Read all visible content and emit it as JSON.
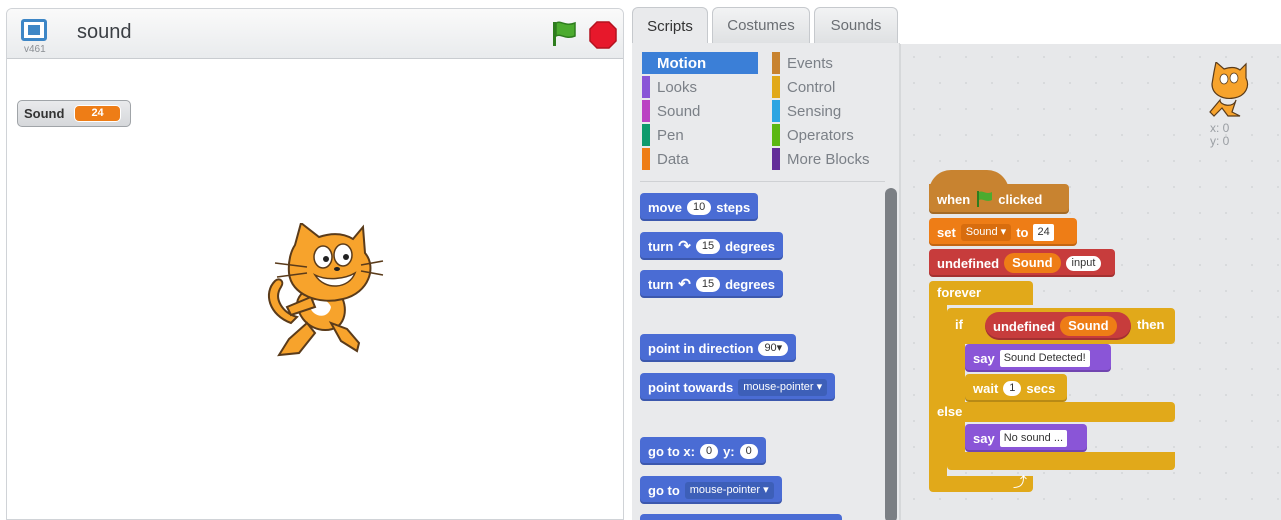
{
  "stage": {
    "title": "sound",
    "version": "v461",
    "monitor": {
      "label": "Sound",
      "value": "24"
    }
  },
  "tabs": [
    {
      "label": "Scripts",
      "active": true
    },
    {
      "label": "Costumes",
      "active": false
    },
    {
      "label": "Sounds",
      "active": false
    }
  ],
  "categories": [
    {
      "label": "Motion",
      "color": "#4a6cd4",
      "active": true
    },
    {
      "label": "Looks",
      "color": "#8a55d7"
    },
    {
      "label": "Sound",
      "color": "#bb42c3"
    },
    {
      "label": "Pen",
      "color": "#0e9a6c"
    },
    {
      "label": "Data",
      "color": "#ee7d16"
    },
    {
      "label": "Events",
      "color": "#c88330"
    },
    {
      "label": "Control",
      "color": "#e1a91a"
    },
    {
      "label": "Sensing",
      "color": "#2ca5e2"
    },
    {
      "label": "Operators",
      "color": "#5cb712"
    },
    {
      "label": "More Blocks",
      "color": "#632d99"
    }
  ],
  "palette": {
    "move": {
      "pre": "move",
      "num": "10",
      "post": "steps"
    },
    "turn_right": {
      "pre": "turn",
      "icon": "rotate-right-icon",
      "num": "15",
      "post": "degrees"
    },
    "turn_left": {
      "pre": "turn",
      "icon": "rotate-left-icon",
      "num": "15",
      "post": "degrees"
    },
    "point_direction": {
      "pre": "point in direction",
      "value": "90▾"
    },
    "point_towards": {
      "pre": "point towards",
      "value": "mouse-pointer ▾"
    },
    "goto_xy": {
      "pre": "go to x:",
      "x": "0",
      "mid": "y:",
      "y": "0"
    },
    "goto": {
      "pre": "go to",
      "value": "mouse-pointer ▾"
    }
  },
  "script": {
    "hat": {
      "pre": "when",
      "post": "clicked"
    },
    "set": {
      "pre": "set",
      "var": "Sound ▾",
      "mid": "to",
      "value": "24"
    },
    "custom": {
      "label": "undefined",
      "arg": "Sound",
      "param": "input"
    },
    "forever": "forever",
    "if": {
      "pre": "if",
      "cond_label": "undefined",
      "cond_arg": "Sound",
      "post": "then"
    },
    "say1": {
      "pre": "say",
      "text": "Sound Detected!"
    },
    "wait": {
      "pre": "wait",
      "num": "1",
      "post": "secs"
    },
    "else": "else",
    "say2": {
      "pre": "say",
      "text": "No sound ..."
    }
  },
  "sprite_info": {
    "x": "x: 0",
    "y": "y: 0"
  }
}
